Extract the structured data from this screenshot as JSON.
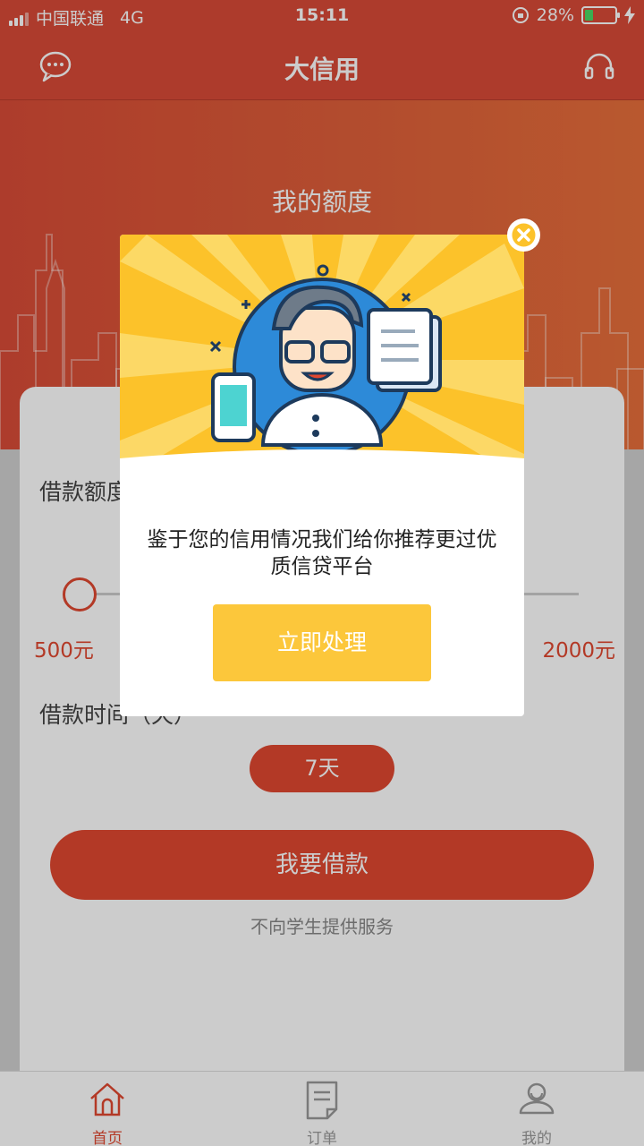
{
  "status_bar": {
    "carrier": "中国联通",
    "network": "4G",
    "time": "15:11",
    "battery_text": "28%",
    "battery_level": 0.28
  },
  "header": {
    "title": "大信用",
    "left_icon": "message-icon",
    "right_icon": "headset-icon"
  },
  "hero": {
    "label": "我的额度"
  },
  "form": {
    "amount_label": "借款额度",
    "min_amount": "500元",
    "max_amount": "2000元",
    "slider_value_fraction": 0,
    "term_label": "借款时间（天）",
    "term_option": "7天",
    "borrow_button": "我要借款",
    "notice": "不向学生提供服务"
  },
  "tabs": [
    {
      "label": "首页",
      "icon": "home-icon",
      "active": true
    },
    {
      "label": "订单",
      "icon": "order-icon",
      "active": false
    },
    {
      "label": "我的",
      "icon": "profile-icon",
      "active": false
    }
  ],
  "modal": {
    "message": "鉴于您的信用情况我们给你推荐更过优质信贷平台",
    "action_button": "立即处理",
    "close_icon": "close-icon"
  },
  "colors": {
    "brand_red": "#d94a37",
    "accent_yellow": "#fcc73b",
    "battery_green": "#4cd964"
  }
}
